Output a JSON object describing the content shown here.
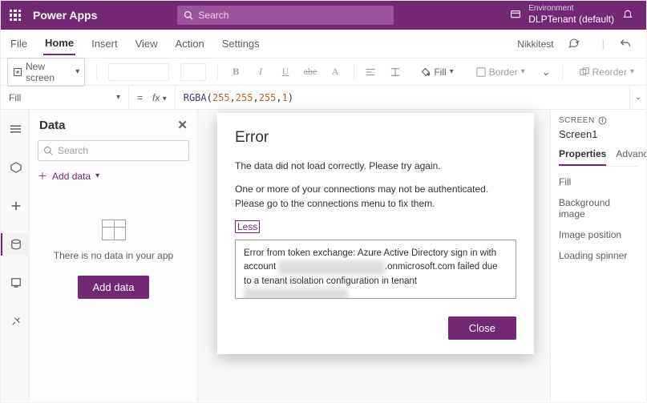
{
  "appbar": {
    "brand": "Power Apps",
    "search_placeholder": "Search",
    "env_label": "Environment",
    "env_name": "DLPTenant (default)"
  },
  "menu": {
    "file": "File",
    "home": "Home",
    "insert": "Insert",
    "view": "View",
    "action": "Action",
    "settings": "Settings",
    "user": "Nikkitest"
  },
  "ribbon": {
    "new_screen": "New screen",
    "fill": "Fill",
    "border": "Border",
    "reorder": "Reorder"
  },
  "fx": {
    "property": "Fill",
    "fn": "RGBA",
    "args": [
      "255",
      "255",
      "255",
      "1"
    ]
  },
  "datapanel": {
    "title": "Data",
    "search_placeholder": "Search",
    "add_data": "Add data",
    "empty": "There is no data in your app",
    "add_button": "Add data"
  },
  "rightpanel": {
    "label": "SCREEN",
    "name": "Screen1",
    "tab_props": "Properties",
    "tab_adv": "Advanced",
    "fill": "Fill",
    "bgimg": "Background image",
    "imgpos": "Image position",
    "spinner": "Loading spinner"
  },
  "modal": {
    "title": "Error",
    "line1": "The data did not load correctly. Please try again.",
    "line2": "One or more of your connections may not be authenticated. Please go to the connections menu to fix them.",
    "less": "Less",
    "details_a": "Error from token exchange: Azure Active Directory sign in with account ",
    "details_b": ".onmicrosoft.com failed due to a tenant isolation configuration in tenant ",
    "close": "Close"
  }
}
